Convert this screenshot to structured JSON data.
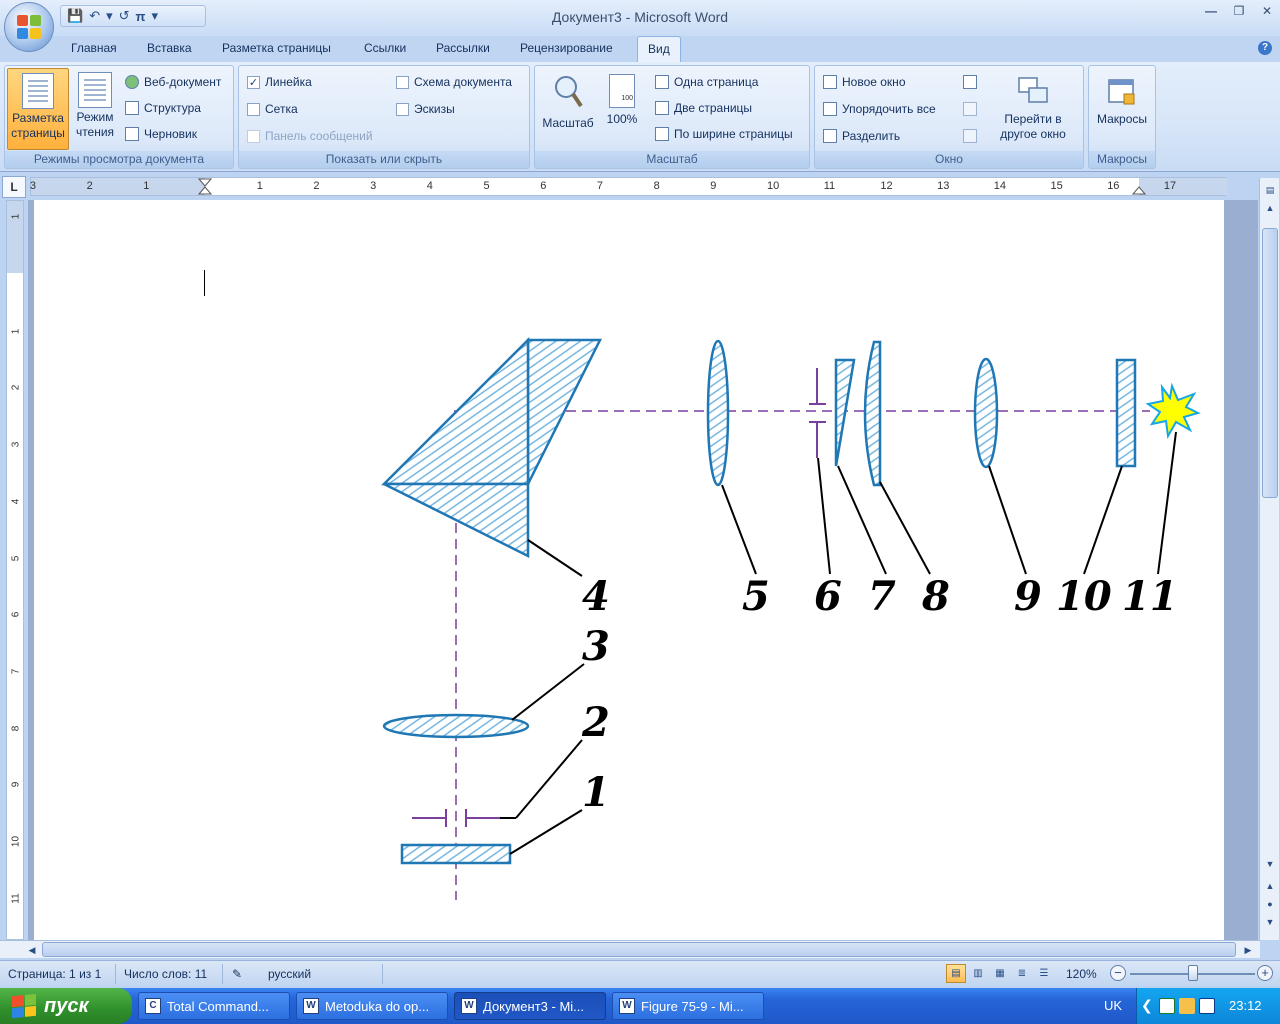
{
  "window": {
    "title": "Документ3 - Microsoft Word",
    "min": "—",
    "restore": "❐",
    "close": "✕"
  },
  "qat": {
    "save": "💾",
    "undo": "↶",
    "undo_dd": "▾",
    "redo": "↺",
    "pi": "π",
    "more": "▾"
  },
  "tabs": [
    "Главная",
    "Вставка",
    "Разметка страницы",
    "Ссылки",
    "Рассылки",
    "Рецензирование",
    "Вид"
  ],
  "active_tab": "Вид",
  "help": "?",
  "ribbon": {
    "views": {
      "label": "Режимы просмотра документа",
      "print_layout": "Разметка страницы",
      "reading": "Режим чтения",
      "web": "Веб-документ",
      "outline": "Структура",
      "draft": "Черновик"
    },
    "show": {
      "label": "Показать или скрыть",
      "ruler": "Линейка",
      "grid": "Сетка",
      "message_bar": "Панель сообщений",
      "doc_map": "Схема документа",
      "thumbnails": "Эскизы",
      "check": "✓"
    },
    "zoom": {
      "label": "Масштаб",
      "zoom": "Масштаб",
      "hundred": "100%",
      "hundred_icon": "100",
      "one_page": "Одна страница",
      "two_pages": "Две страницы",
      "page_width": "По ширине страницы"
    },
    "window": {
      "label": "Окно",
      "new_window": "Новое окно",
      "arrange_all": "Упорядочить все",
      "split": "Разделить",
      "switch": "Перейти в другое окно"
    },
    "macros": {
      "label": "Макросы",
      "macros": "Макросы"
    }
  },
  "ruler": {
    "corner": "L",
    "h_ticks": [
      "3",
      "2",
      "1",
      "1",
      "2",
      "3",
      "4",
      "5",
      "6",
      "7",
      "8",
      "9",
      "10",
      "11",
      "12",
      "13",
      "14",
      "15",
      "16",
      "17"
    ],
    "v_ticks": [
      "1",
      "1",
      "2",
      "3",
      "4",
      "5",
      "6",
      "7",
      "8",
      "9",
      "10",
      "11"
    ]
  },
  "figure": {
    "labels": [
      "1",
      "2",
      "3",
      "4",
      "5",
      "6",
      "7",
      "8",
      "9",
      "10",
      "11"
    ],
    "colors": {
      "outline": "#1f77b4",
      "axis": "#7b3f9e",
      "hatch": "#5aa6d8",
      "star": "#ffff00",
      "star_edge": "#16a6e8"
    }
  },
  "statusbar": {
    "page": "Страница: 1 из 1",
    "words": "Число слов: 11",
    "lang": "русский",
    "zoom": "120%"
  },
  "taskbar": {
    "start": "пуск",
    "tasks": [
      "Total Command...",
      "Metoduka do op...",
      "Документ3 - Mi...",
      "Figure 75-9 - Mi..."
    ],
    "lang": "UK",
    "clock": "23:12"
  }
}
